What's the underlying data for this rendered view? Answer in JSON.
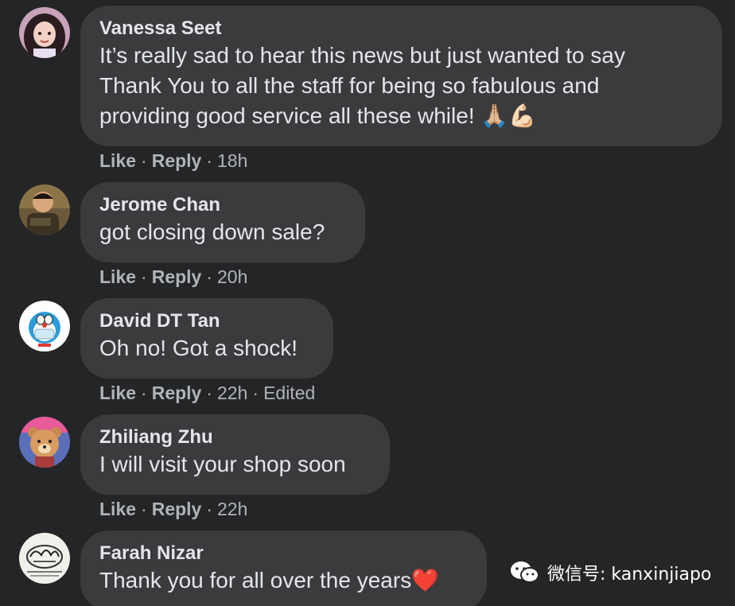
{
  "comments": [
    {
      "author": "Vanessa Seet",
      "lines": [
        "It’s really sad to hear this news but just wanted to say",
        "Thank You to all the staff for being so fabulous and",
        "providing good service all these while! 🙏🏼💪🏻"
      ],
      "like": "Like",
      "reply": "Reply",
      "time": "18h"
    },
    {
      "author": "Jerome Chan",
      "lines": [
        "got closing down sale?"
      ],
      "like": "Like",
      "reply": "Reply",
      "time": "20h"
    },
    {
      "author": "David DT Tan",
      "lines": [
        "Oh no! Got a shock!"
      ],
      "like": "Like",
      "reply": "Reply",
      "time": "22h",
      "edited": "Edited"
    },
    {
      "author": "Zhiliang Zhu",
      "lines": [
        "I will visit your shop soon"
      ],
      "like": "Like",
      "reply": "Reply",
      "time": "22h"
    },
    {
      "author": "Farah Nizar",
      "lines": [
        "Thank you for all over the years❤️"
      ]
    }
  ],
  "separator": "·",
  "watermark": {
    "text": "微信号: kanxinjiapo",
    "icon": "wechat-icon"
  },
  "colors": {
    "background": "#242526",
    "bubble": "#3a3b3c",
    "text": "#e4e6eb",
    "meta": "#b0b3b8",
    "heart": "#e0245e"
  }
}
